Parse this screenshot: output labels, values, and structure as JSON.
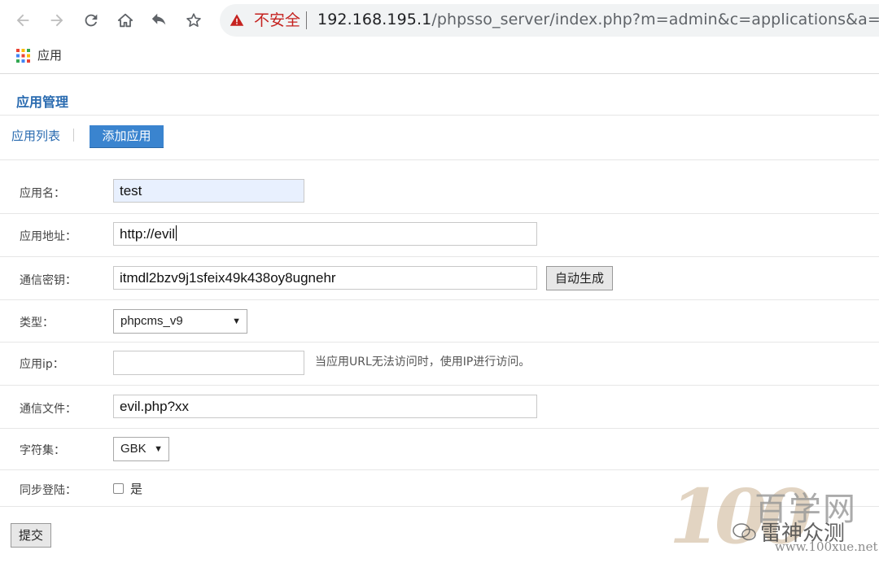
{
  "browser": {
    "security_label": "不安全",
    "url_host": "192.168.195.1",
    "url_path": "/phpsso_server/index.php?m=admin&c=applications&a=add",
    "bookmark_apps_label": "应用"
  },
  "page": {
    "title": "应用管理",
    "tabs": [
      {
        "label": "应用列表"
      },
      {
        "label": "添加应用"
      }
    ]
  },
  "form": {
    "app_name": {
      "label": "应用名：",
      "value": "test"
    },
    "app_url": {
      "label": "应用地址：",
      "value": "http://evil"
    },
    "auth_key": {
      "label": "通信密钥：",
      "value": "itmdl2bzv9j1sfeix49k438oy8ugnehr",
      "button_label": "自动生成"
    },
    "type": {
      "label": "类型：",
      "selected": "phpcms_v9"
    },
    "app_ip": {
      "label": "应用ip：",
      "value": "",
      "hint": "当应用URL无法访问时，使用IP进行访问。"
    },
    "api_file": {
      "label": "通信文件：",
      "value": "evil.php?xx"
    },
    "charset": {
      "label": "字符集：",
      "selected": "GBK"
    },
    "sync_login": {
      "label": "同步登陆：",
      "option_label": "是",
      "checked": false
    },
    "submit_label": "提交"
  },
  "watermark": {
    "number": "100",
    "brand": "百学网",
    "sub": "雷神众测",
    "url": "www.100xue.net"
  },
  "colors": {
    "accent": "#3a84cf",
    "link": "#2a6bb0",
    "warning": "#c5221f"
  }
}
